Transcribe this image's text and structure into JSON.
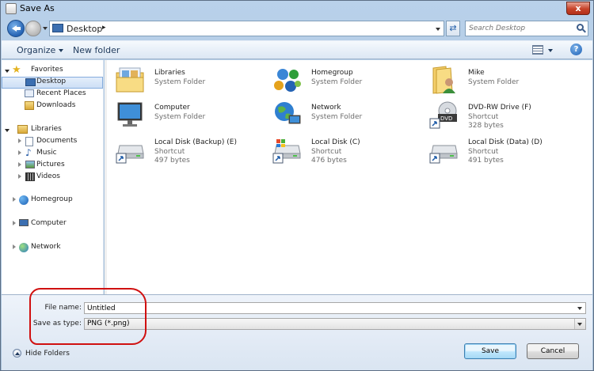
{
  "window": {
    "title": "Save As",
    "close_label": "x"
  },
  "address": {
    "location": "Desktop",
    "separator": "▸"
  },
  "search": {
    "placeholder": "Search Desktop"
  },
  "toolbar": {
    "organize_label": "Organize",
    "new_folder_label": "New folder",
    "help_label": "?"
  },
  "navpane": {
    "favorites": {
      "label": "Favorites",
      "items": [
        "Desktop",
        "Recent Places",
        "Downloads"
      ]
    },
    "libraries": {
      "label": "Libraries",
      "items": [
        "Documents",
        "Music",
        "Pictures",
        "Videos"
      ]
    },
    "homegroup": "Homegroup",
    "computer": "Computer",
    "network": "Network"
  },
  "content": {
    "items": [
      {
        "name": "Libraries",
        "sub1": "System Folder",
        "sub2": ""
      },
      {
        "name": "Homegroup",
        "sub1": "System Folder",
        "sub2": ""
      },
      {
        "name": "Mike",
        "sub1": "System Folder",
        "sub2": ""
      },
      {
        "name": "Computer",
        "sub1": "System Folder",
        "sub2": ""
      },
      {
        "name": "Network",
        "sub1": "System Folder",
        "sub2": ""
      },
      {
        "name": "DVD-RW Drive (F)",
        "sub1": "Shortcut",
        "sub2": "328 bytes"
      },
      {
        "name": "Local Disk (Backup) (E)",
        "sub1": "Shortcut",
        "sub2": "497 bytes"
      },
      {
        "name": "Local Disk (C)",
        "sub1": "Shortcut",
        "sub2": "476 bytes"
      },
      {
        "name": "Local Disk (Data) (D)",
        "sub1": "Shortcut",
        "sub2": "491 bytes"
      }
    ]
  },
  "form": {
    "file_name_label": "File name:",
    "file_name_value": "Untitled",
    "save_type_label": "Save as type:",
    "save_type_value": "PNG (*.png)"
  },
  "footer": {
    "hide_folders_label": "Hide Folders",
    "save_label": "Save",
    "cancel_label": "Cancel"
  },
  "colors": {
    "annotation": "#d01010",
    "title_bar": "#b9d1ea",
    "selection": "#cddff5"
  }
}
